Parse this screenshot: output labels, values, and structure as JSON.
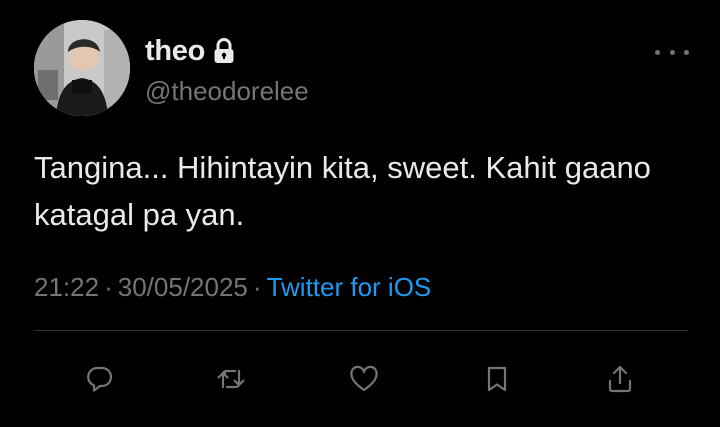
{
  "author": {
    "display_name": "theo",
    "handle": "@theodorelee",
    "avatar": "profile-photo",
    "protected_icon": "lock-icon"
  },
  "tweet": {
    "text": "Tangina... Hihintayin kita, sweet. Kahit gaano katagal pa yan."
  },
  "meta": {
    "time": "21:22",
    "separator": "·",
    "date": "30/05/2025",
    "source": "Twitter for iOS"
  },
  "actions": [
    "reply-icon",
    "retweet-icon",
    "like-icon",
    "bookmark-icon",
    "share-icon"
  ],
  "colors": {
    "background": "#000000",
    "primary_text": "#e7e9ea",
    "secondary_text": "#71767b",
    "link": "#1d9bf0",
    "divider": "#2f3336"
  }
}
